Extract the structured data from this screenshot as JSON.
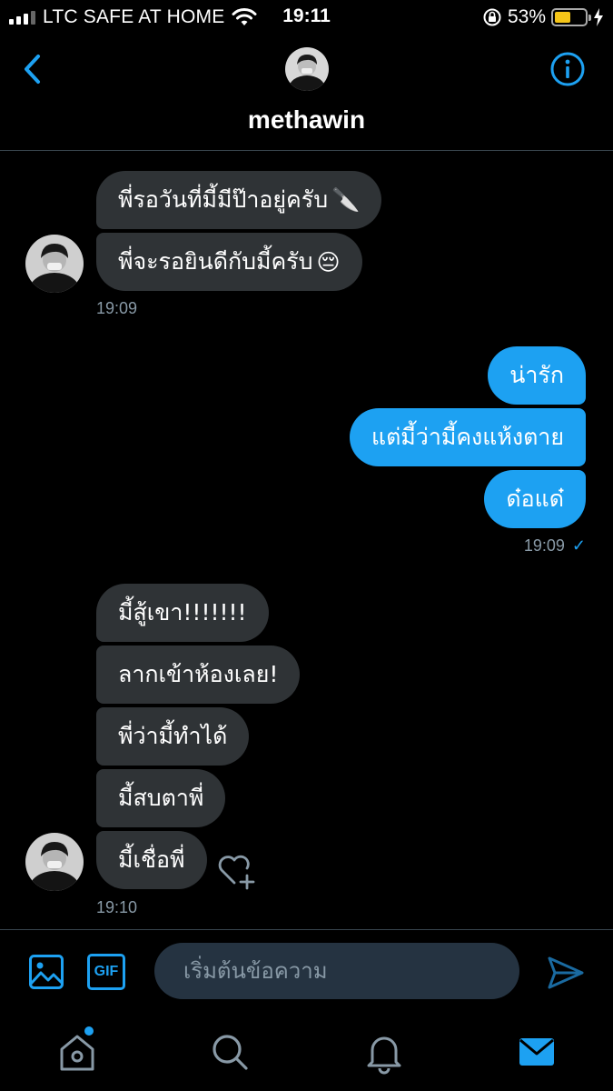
{
  "status_bar": {
    "carrier": "LTC SAFE AT HOME",
    "time": "19:11",
    "battery_percent": "53%",
    "battery_level": 0.53,
    "icons": [
      "signal-icon",
      "wifi-icon",
      "orientation-lock-icon",
      "battery-icon",
      "charging-bolt-icon"
    ]
  },
  "header": {
    "name": "methawin",
    "back_icon": "chevron-left-icon",
    "info_icon": "info-icon"
  },
  "colors": {
    "accent": "#1da1f2",
    "incoming_bubble": "#2f3336",
    "background": "#000000",
    "muted_text": "#8899a6"
  },
  "messages": {
    "group1": {
      "bubbles": [
        "พี่รอวันที่มี้มีป๊าอยู่ครับ",
        "พี่จะรอยินดีกับมี้ครับ"
      ],
      "emoji": [
        "🔪",
        "😔"
      ],
      "time": "19:09"
    },
    "group2": {
      "bubbles": [
        "น่ารัก",
        "แต่มี้ว่ามี้คงแห้งตาย",
        "ด๋อแด๋"
      ],
      "time": "19:09",
      "read_receipt": "✓"
    },
    "group3": {
      "bubbles": [
        "มี้สู้เขา!!!!!!!",
        "ลากเข้าห้องเลย!",
        "พี่ว่ามี้ทำได้",
        "มี้สบตาพี่",
        "มี้เชื่อพี่"
      ],
      "time": "19:10"
    }
  },
  "composer": {
    "placeholder": "เริ่มต้นข้อความ",
    "gif_label": "GIF"
  },
  "tabbar": {
    "tabs": [
      "home-icon",
      "search-icon",
      "notifications-icon",
      "messages-icon"
    ],
    "active": "messages-icon"
  }
}
